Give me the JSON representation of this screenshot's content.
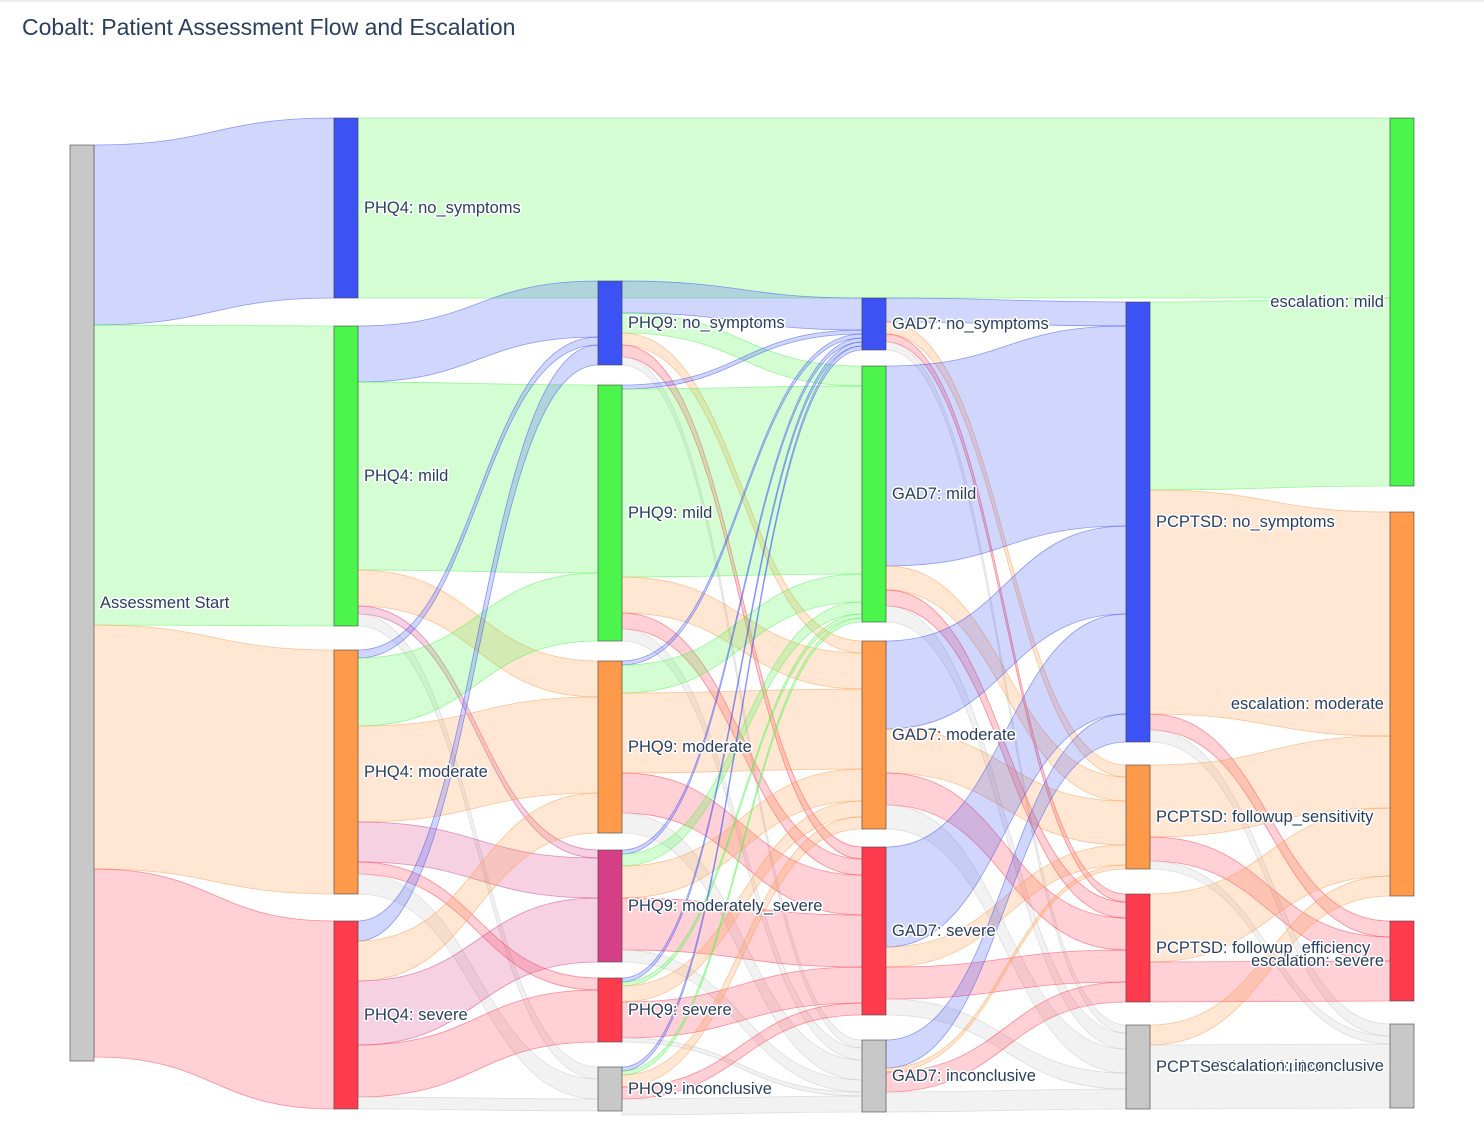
{
  "chart_data": {
    "type": "sankey",
    "title": "Cobalt: Patient Assessment Flow and Escalation",
    "nodes": [
      {
        "id": "start",
        "label": "Assessment Start",
        "color": "#c8c8c8",
        "value": 229
      },
      {
        "id": "phq4_none",
        "label": "PHQ4: no_symptoms",
        "color": "#3d52f5",
        "value": 45
      },
      {
        "id": "phq4_mild",
        "label": "PHQ4: mild",
        "color": "#4cf54c",
        "value": 75
      },
      {
        "id": "phq4_mod",
        "label": "PHQ4: moderate",
        "color": "#ff9a4a",
        "value": 61
      },
      {
        "id": "phq4_sev",
        "label": "PHQ4: severe",
        "color": "#ff3c4e",
        "value": 47
      },
      {
        "id": "phq9_none",
        "label": "PHQ9: no_symptoms",
        "color": "#3d52f5",
        "value": 21
      },
      {
        "id": "phq9_mild",
        "label": "PHQ9: mild",
        "color": "#4cf54c",
        "value": 64
      },
      {
        "id": "phq9_mod",
        "label": "PHQ9: moderate",
        "color": "#ff9a4a",
        "value": 43
      },
      {
        "id": "phq9_msev",
        "label": "PHQ9: moderately_severe",
        "color": "#d63e86",
        "value": 28
      },
      {
        "id": "phq9_sev",
        "label": "PHQ9: severe",
        "color": "#ff3c4e",
        "value": 16
      },
      {
        "id": "phq9_inc",
        "label": "PHQ9: inconclusive",
        "color": "#c8c8c8",
        "value": 11
      },
      {
        "id": "gad7_none",
        "label": "GAD7: no_symptoms",
        "color": "#3d52f5",
        "value": 13
      },
      {
        "id": "gad7_mild",
        "label": "GAD7: mild",
        "color": "#4cf54c",
        "value": 64
      },
      {
        "id": "gad7_mod",
        "label": "GAD7: moderate",
        "color": "#ff9a4a",
        "value": 47
      },
      {
        "id": "gad7_sev",
        "label": "GAD7: severe",
        "color": "#ff3c4e",
        "value": 42
      },
      {
        "id": "gad7_inc",
        "label": "GAD7: inconclusive",
        "color": "#c8c8c8",
        "value": 18
      },
      {
        "id": "pc_none",
        "label": "PCPTSD: no_symptoms",
        "color": "#3d52f5",
        "value": 110
      },
      {
        "id": "pc_fsens",
        "label": "PCPTSD: followup_sensitivity",
        "color": "#ff9a4a",
        "value": 26
      },
      {
        "id": "pc_feff",
        "label": "PCPTSD: followup_efficiency",
        "color": "#ff3c4e",
        "value": 27
      },
      {
        "id": "pc_inc",
        "label": "PCPTSD: inconclusive",
        "color": "#c8c8c8",
        "value": 21
      },
      {
        "id": "esc_mild",
        "label": "escalation: mild",
        "color": "#4cf54c",
        "value": 92
      },
      {
        "id": "esc_mod",
        "label": "escalation: moderate",
        "color": "#ff9a4a",
        "value": 96
      },
      {
        "id": "esc_sev",
        "label": "escalation: severe",
        "color": "#ff3c4e",
        "value": 20
      },
      {
        "id": "esc_inc",
        "label": "escalation: inconclusive",
        "color": "#c8c8c8",
        "value": 21
      }
    ],
    "links": [
      {
        "source": "start",
        "target": "phq4_none",
        "value": 45
      },
      {
        "source": "start",
        "target": "phq4_mild",
        "value": 75
      },
      {
        "source": "start",
        "target": "phq4_mod",
        "value": 61
      },
      {
        "source": "start",
        "target": "phq4_sev",
        "value": 47
      },
      {
        "source": "phq4_none",
        "target": "esc_mild",
        "value": 45
      },
      {
        "source": "phq4_mild",
        "target": "phq9_none",
        "value": 14
      },
      {
        "source": "phq4_mild",
        "target": "phq9_mild",
        "value": 47
      },
      {
        "source": "phq4_mild",
        "target": "phq9_mod",
        "value": 9
      },
      {
        "source": "phq4_mild",
        "target": "phq9_msev",
        "value": 2
      },
      {
        "source": "phq4_mild",
        "target": "phq9_inc",
        "value": 3
      },
      {
        "source": "phq4_mod",
        "target": "phq9_none",
        "value": 2
      },
      {
        "source": "phq4_mod",
        "target": "phq9_mild",
        "value": 17
      },
      {
        "source": "phq4_mod",
        "target": "phq9_mod",
        "value": 24
      },
      {
        "source": "phq4_mod",
        "target": "phq9_msev",
        "value": 10
      },
      {
        "source": "phq4_mod",
        "target": "phq9_sev",
        "value": 3
      },
      {
        "source": "phq4_mod",
        "target": "phq9_inc",
        "value": 5
      },
      {
        "source": "phq4_sev",
        "target": "phq9_none",
        "value": 5
      },
      {
        "source": "phq4_sev",
        "target": "phq9_mod",
        "value": 10
      },
      {
        "source": "phq4_sev",
        "target": "phq9_msev",
        "value": 16
      },
      {
        "source": "phq4_sev",
        "target": "phq9_sev",
        "value": 13
      },
      {
        "source": "phq4_sev",
        "target": "phq9_inc",
        "value": 3
      },
      {
        "source": "phq9_none",
        "target": "gad7_none",
        "value": 8
      },
      {
        "source": "phq9_none",
        "target": "gad7_mild",
        "value": 5
      },
      {
        "source": "phq9_none",
        "target": "gad7_mod",
        "value": 3
      },
      {
        "source": "phq9_none",
        "target": "gad7_sev",
        "value": 3
      },
      {
        "source": "phq9_none",
        "target": "gad7_inc",
        "value": 2
      },
      {
        "source": "phq9_mild",
        "target": "gad7_none",
        "value": 1
      },
      {
        "source": "phq9_mild",
        "target": "gad7_mild",
        "value": 47
      },
      {
        "source": "phq9_mild",
        "target": "gad7_mod",
        "value": 9
      },
      {
        "source": "phq9_mild",
        "target": "gad7_sev",
        "value": 4
      },
      {
        "source": "phq9_mild",
        "target": "gad7_inc",
        "value": 3
      },
      {
        "source": "phq9_mod",
        "target": "gad7_none",
        "value": 1
      },
      {
        "source": "phq9_mod",
        "target": "gad7_mild",
        "value": 7
      },
      {
        "source": "phq9_mod",
        "target": "gad7_mod",
        "value": 20
      },
      {
        "source": "phq9_mod",
        "target": "gad7_sev",
        "value": 10
      },
      {
        "source": "phq9_mod",
        "target": "gad7_inc",
        "value": 5
      },
      {
        "source": "phq9_msev",
        "target": "gad7_none",
        "value": 1
      },
      {
        "source": "phq9_msev",
        "target": "gad7_mild",
        "value": 3
      },
      {
        "source": "phq9_msev",
        "target": "gad7_mod",
        "value": 8
      },
      {
        "source": "phq9_msev",
        "target": "gad7_sev",
        "value": 13
      },
      {
        "source": "phq9_msev",
        "target": "gad7_inc",
        "value": 3
      },
      {
        "source": "phq9_sev",
        "target": "gad7_none",
        "value": 1
      },
      {
        "source": "phq9_sev",
        "target": "gad7_mild",
        "value": 1
      },
      {
        "source": "phq9_sev",
        "target": "gad7_mod",
        "value": 4
      },
      {
        "source": "phq9_sev",
        "target": "gad7_sev",
        "value": 9
      },
      {
        "source": "phq9_sev",
        "target": "gad7_inc",
        "value": 1
      },
      {
        "source": "phq9_inc",
        "target": "gad7_none",
        "value": 1
      },
      {
        "source": "phq9_inc",
        "target": "gad7_mild",
        "value": 1
      },
      {
        "source": "phq9_inc",
        "target": "gad7_mod",
        "value": 3
      },
      {
        "source": "phq9_inc",
        "target": "gad7_sev",
        "value": 3
      },
      {
        "source": "phq9_inc",
        "target": "gad7_inc",
        "value": 4
      },
      {
        "source": "gad7_none",
        "target": "pc_none",
        "value": 6
      },
      {
        "source": "gad7_none",
        "target": "pc_fsens",
        "value": 3
      },
      {
        "source": "gad7_none",
        "target": "pc_feff",
        "value": 2
      },
      {
        "source": "gad7_none",
        "target": "pc_inc",
        "value": 2
      },
      {
        "source": "gad7_mild",
        "target": "pc_none",
        "value": 50
      },
      {
        "source": "gad7_mild",
        "target": "pc_fsens",
        "value": 6
      },
      {
        "source": "gad7_mild",
        "target": "pc_feff",
        "value": 4
      },
      {
        "source": "gad7_mild",
        "target": "pc_inc",
        "value": 4
      },
      {
        "source": "gad7_mod",
        "target": "pc_none",
        "value": 22
      },
      {
        "source": "gad7_mod",
        "target": "pc_fsens",
        "value": 11
      },
      {
        "source": "gad7_mod",
        "target": "pc_feff",
        "value": 8
      },
      {
        "source": "gad7_mod",
        "target": "pc_inc",
        "value": 6
      },
      {
        "source": "gad7_sev",
        "target": "pc_none",
        "value": 25
      },
      {
        "source": "gad7_sev",
        "target": "pc_fsens",
        "value": 5
      },
      {
        "source": "gad7_sev",
        "target": "pc_feff",
        "value": 8
      },
      {
        "source": "gad7_sev",
        "target": "pc_inc",
        "value": 4
      },
      {
        "source": "gad7_inc",
        "target": "pc_none",
        "value": 7
      },
      {
        "source": "gad7_inc",
        "target": "pc_fsens",
        "value": 1
      },
      {
        "source": "gad7_inc",
        "target": "pc_feff",
        "value": 5
      },
      {
        "source": "gad7_inc",
        "target": "pc_inc",
        "value": 5
      },
      {
        "source": "pc_none",
        "target": "esc_mild",
        "value": 47
      },
      {
        "source": "pc_none",
        "target": "esc_mod",
        "value": 56
      },
      {
        "source": "pc_none",
        "target": "esc_sev",
        "value": 4
      },
      {
        "source": "pc_none",
        "target": "esc_inc",
        "value": 3
      },
      {
        "source": "pc_fsens",
        "target": "esc_mod",
        "value": 18
      },
      {
        "source": "pc_fsens",
        "target": "esc_sev",
        "value": 6
      },
      {
        "source": "pc_fsens",
        "target": "esc_inc",
        "value": 2
      },
      {
        "source": "pc_feff",
        "target": "esc_mod",
        "value": 17
      },
      {
        "source": "pc_feff",
        "target": "esc_sev",
        "value": 10
      },
      {
        "source": "pc_inc",
        "target": "esc_mod",
        "value": 5
      },
      {
        "source": "pc_inc",
        "target": "esc_inc",
        "value": 16
      }
    ]
  }
}
